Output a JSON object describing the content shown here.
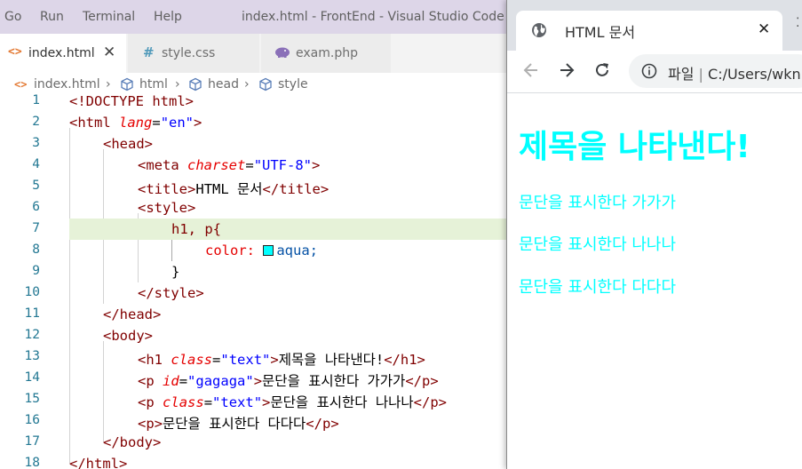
{
  "menubar": {
    "items": [
      "Go",
      "Run",
      "Terminal",
      "Help"
    ],
    "window_title": "index.html - FrontEnd - Visual Studio Code"
  },
  "editor_tabs": [
    {
      "label": "index.html",
      "icon": "html-file-icon",
      "active": true
    },
    {
      "label": "style.css",
      "icon": "css-hash-icon",
      "active": false
    },
    {
      "label": "exam.php",
      "icon": "php-elephant-icon",
      "active": false
    }
  ],
  "breadcrumb": [
    "index.html",
    "html",
    "head",
    "style"
  ],
  "code": {
    "line_numbers": [
      "1",
      "2",
      "3",
      "4",
      "5",
      "6",
      "7",
      "8",
      "9",
      "10",
      "11",
      "12",
      "13",
      "14",
      "15",
      "16",
      "17",
      "18"
    ],
    "doctype": "<!DOCTYPE html>",
    "html_open": {
      "tag": "html",
      "attr": "lang",
      "value": "\"en\""
    },
    "head_tag": "head",
    "meta": {
      "tag": "meta",
      "attr": "charset",
      "value": "\"UTF-8\""
    },
    "title_tag": "title",
    "title_text": "HTML 문서",
    "style_tag": "style",
    "selector": "h1, p{",
    "property": "color:",
    "color_value": "aqua;",
    "close_brace": "}",
    "body_tag": "body",
    "h1": {
      "tag": "h1",
      "attr": "class",
      "value": "\"text\"",
      "text": "제목을 나타낸다!"
    },
    "p1": {
      "tag": "p",
      "attr": "id",
      "value": "\"gagaga\"",
      "text": "문단을 표시한다 가가가"
    },
    "p2": {
      "tag": "p",
      "attr": "class",
      "value": "\"text\"",
      "text": "문단을 표시한다 나나나"
    },
    "p3": {
      "tag": "p",
      "text": "문단을 표시한다 다다다"
    },
    "highlighted_line": "7"
  },
  "browser": {
    "tab_title": "HTML 문서",
    "url_label": "파일",
    "url": "C:/Users/wkn",
    "page": {
      "heading": "제목을 나타낸다!",
      "paragraphs": [
        "문단을 표시한다 가가가",
        "문단을 표시한다 나나나",
        "문단을 표시한다 다다다"
      ],
      "text_color": "#00ffff"
    }
  },
  "colors": {
    "menubar_bg": "#ddd6e8",
    "line_highlight": "#e6f2d8",
    "aqua": "#00ffff"
  }
}
